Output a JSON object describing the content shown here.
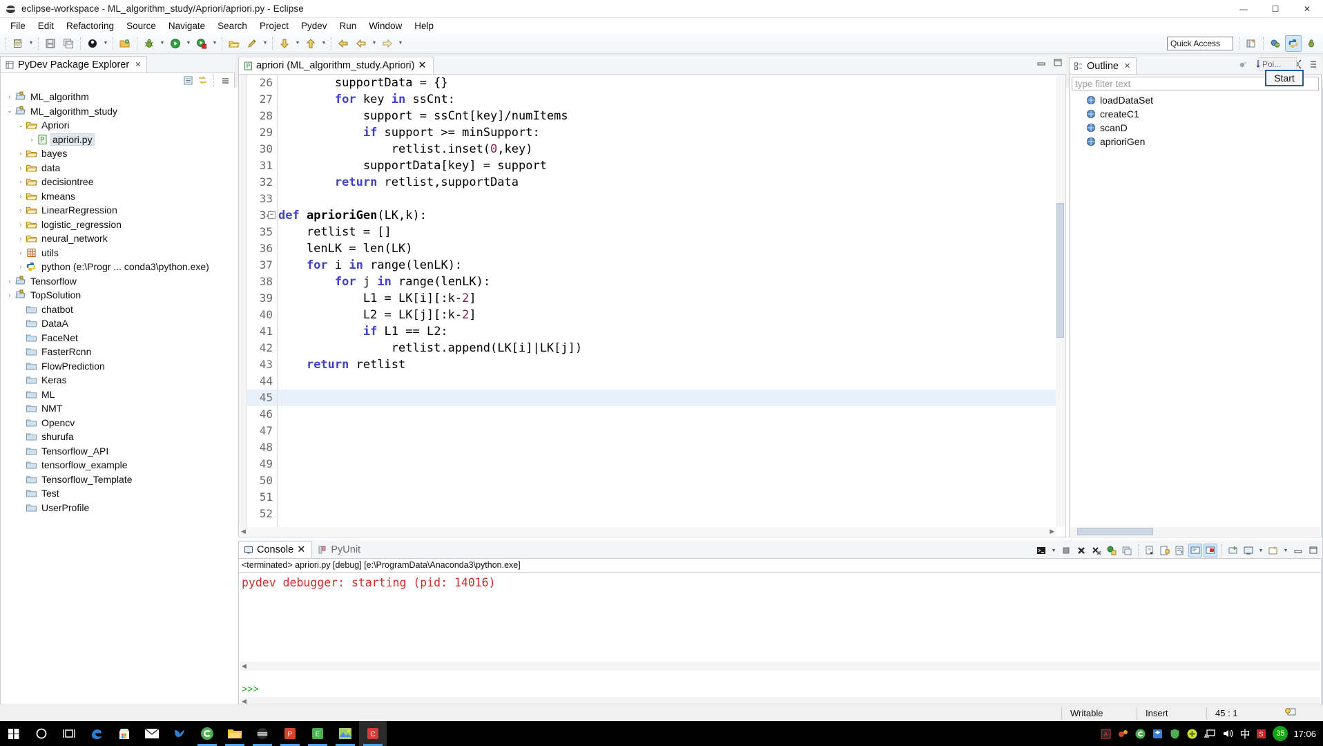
{
  "window": {
    "title": "eclipse-workspace - ML_algorithm_study/Apriori/apriori.py - Eclipse",
    "minimize": "—",
    "maximize": "☐",
    "close": "✕"
  },
  "menu": [
    "File",
    "Edit",
    "Refactoring",
    "Source",
    "Navigate",
    "Search",
    "Project",
    "Pydev",
    "Run",
    "Window",
    "Help"
  ],
  "toolbar": {
    "quick_access_placeholder": "Quick Access",
    "buttons": [
      {
        "name": "new-wizard",
        "icon": "new-file-icon"
      },
      {
        "name": "save",
        "icon": "save-icon"
      },
      {
        "name": "save-all",
        "icon": "save-all-icon"
      },
      {
        "name": "pydev-package",
        "icon": "black-circle-icon"
      },
      {
        "name": "open-folder",
        "icon": "open-folder-icon"
      },
      {
        "name": "debug",
        "icon": "bug-icon"
      },
      {
        "name": "run",
        "icon": "run-green-icon"
      },
      {
        "name": "coverage",
        "icon": "coverage-icon"
      },
      {
        "name": "external-tools",
        "icon": "toolbox-icon"
      },
      {
        "name": "pencil",
        "icon": "pencil-icon"
      },
      {
        "name": "next-annotation",
        "icon": "down-arrow-icon"
      },
      {
        "name": "previous-annotation",
        "icon": "up-arrow-icon"
      },
      {
        "name": "back",
        "icon": "back-arrow-icon"
      },
      {
        "name": "forward-left",
        "icon": "left-arrow-icon"
      },
      {
        "name": "forward",
        "icon": "right-arrow-icon"
      }
    ]
  },
  "package_explorer": {
    "tab_label": "PyDev Package Explorer",
    "tree": [
      {
        "label": "ML_algorithm",
        "indent": 0,
        "twist": "›",
        "icon": "project-icon",
        "selected": false
      },
      {
        "label": "ML_algorithm_study",
        "indent": 0,
        "twist": "⌄",
        "icon": "project-icon",
        "selected": false
      },
      {
        "label": "Apriori",
        "indent": 1,
        "twist": "⌄",
        "icon": "folder-icon",
        "selected": false
      },
      {
        "label": "apriori.py",
        "indent": 2,
        "twist": "›",
        "icon": "python-file-icon",
        "selected": true
      },
      {
        "label": "bayes",
        "indent": 1,
        "twist": "›",
        "icon": "folder-icon",
        "selected": false
      },
      {
        "label": "data",
        "indent": 1,
        "twist": "›",
        "icon": "folder-icon",
        "selected": false
      },
      {
        "label": "decisiontree",
        "indent": 1,
        "twist": "›",
        "icon": "folder-icon",
        "selected": false
      },
      {
        "label": "kmeans",
        "indent": 1,
        "twist": "›",
        "icon": "folder-icon",
        "selected": false
      },
      {
        "label": "LinearRegression",
        "indent": 1,
        "twist": "›",
        "icon": "folder-icon",
        "selected": false
      },
      {
        "label": "logistic_regression",
        "indent": 1,
        "twist": "›",
        "icon": "folder-icon",
        "selected": false
      },
      {
        "label": "neural_network",
        "indent": 1,
        "twist": "›",
        "icon": "folder-icon",
        "selected": false
      },
      {
        "label": "utils",
        "indent": 1,
        "twist": "›",
        "icon": "grid-icon",
        "selected": false
      },
      {
        "label": "python  (e:\\Progr ... conda3\\python.exe)",
        "indent": 1,
        "twist": "›",
        "icon": "python-interp-icon",
        "selected": false
      },
      {
        "label": "Tensorflow",
        "indent": 0,
        "twist": "›",
        "icon": "project-icon",
        "selected": false
      },
      {
        "label": "TopSolution",
        "indent": 0,
        "twist": "›",
        "icon": "project-icon",
        "selected": false
      },
      {
        "label": "chatbot",
        "indent": 1,
        "twist": "",
        "icon": "closed-folder-icon",
        "selected": false
      },
      {
        "label": "DataA",
        "indent": 1,
        "twist": "",
        "icon": "closed-folder-icon",
        "selected": false
      },
      {
        "label": "FaceNet",
        "indent": 1,
        "twist": "",
        "icon": "closed-folder-icon",
        "selected": false
      },
      {
        "label": "FasterRcnn",
        "indent": 1,
        "twist": "",
        "icon": "closed-folder-icon",
        "selected": false
      },
      {
        "label": "FlowPrediction",
        "indent": 1,
        "twist": "",
        "icon": "closed-folder-icon",
        "selected": false
      },
      {
        "label": "Keras",
        "indent": 1,
        "twist": "",
        "icon": "closed-folder-icon",
        "selected": false
      },
      {
        "label": "ML",
        "indent": 1,
        "twist": "",
        "icon": "closed-folder-icon",
        "selected": false
      },
      {
        "label": "NMT",
        "indent": 1,
        "twist": "",
        "icon": "closed-folder-icon",
        "selected": false
      },
      {
        "label": "Opencv",
        "indent": 1,
        "twist": "",
        "icon": "closed-folder-icon",
        "selected": false
      },
      {
        "label": "shurufa",
        "indent": 1,
        "twist": "",
        "icon": "closed-folder-icon",
        "selected": false
      },
      {
        "label": "Tensorflow_API",
        "indent": 1,
        "twist": "",
        "icon": "closed-folder-icon",
        "selected": false
      },
      {
        "label": "tensorflow_example",
        "indent": 1,
        "twist": "",
        "icon": "closed-folder-icon",
        "selected": false
      },
      {
        "label": "Tensorflow_Template",
        "indent": 1,
        "twist": "",
        "icon": "closed-folder-icon",
        "selected": false
      },
      {
        "label": "Test",
        "indent": 1,
        "twist": "",
        "icon": "closed-folder-icon",
        "selected": false
      },
      {
        "label": "UserProfile",
        "indent": 1,
        "twist": "",
        "icon": "closed-folder-icon",
        "selected": false
      }
    ]
  },
  "editor": {
    "tab_label": "apriori (ML_algorithm_study.Apriori)",
    "first_line_number": 26,
    "current_line": 45,
    "lines": [
      {
        "n": 26,
        "tokens": [
          {
            "t": "        supportData = {}",
            "c": ""
          }
        ]
      },
      {
        "n": 27,
        "tokens": [
          {
            "t": "        ",
            "c": ""
          },
          {
            "t": "for",
            "c": "kw"
          },
          {
            "t": " key ",
            "c": ""
          },
          {
            "t": "in",
            "c": "kw"
          },
          {
            "t": " ssCnt:",
            "c": ""
          }
        ]
      },
      {
        "n": 28,
        "tokens": [
          {
            "t": "            support = ssCnt[key]/numItems",
            "c": ""
          }
        ]
      },
      {
        "n": 29,
        "tokens": [
          {
            "t": "            ",
            "c": ""
          },
          {
            "t": "if",
            "c": "kw"
          },
          {
            "t": " support >= minSupport:",
            "c": ""
          }
        ]
      },
      {
        "n": 30,
        "tokens": [
          {
            "t": "                retlist.inset(",
            "c": ""
          },
          {
            "t": "0",
            "c": "num"
          },
          {
            "t": ",key)",
            "c": ""
          }
        ]
      },
      {
        "n": 31,
        "tokens": [
          {
            "t": "            supportData[key] = support",
            "c": ""
          }
        ]
      },
      {
        "n": 32,
        "tokens": [
          {
            "t": "        ",
            "c": ""
          },
          {
            "t": "return",
            "c": "kw"
          },
          {
            "t": " retlist,supportData",
            "c": ""
          }
        ]
      },
      {
        "n": 33,
        "tokens": [
          {
            "t": "",
            "c": ""
          }
        ]
      },
      {
        "n": 34,
        "fold": true,
        "tokens": [
          {
            "t": "def",
            "c": "kw"
          },
          {
            "t": " ",
            "c": ""
          },
          {
            "t": "aprioriGen",
            "c": "fname"
          },
          {
            "t": "(LK,k):",
            "c": ""
          }
        ]
      },
      {
        "n": 35,
        "tokens": [
          {
            "t": "    retlist = []",
            "c": ""
          }
        ]
      },
      {
        "n": 36,
        "tokens": [
          {
            "t": "    lenLK = len(LK)",
            "c": ""
          }
        ]
      },
      {
        "n": 37,
        "tokens": [
          {
            "t": "    ",
            "c": ""
          },
          {
            "t": "for",
            "c": "kw"
          },
          {
            "t": " i ",
            "c": ""
          },
          {
            "t": "in",
            "c": "kw"
          },
          {
            "t": " range(lenLK):",
            "c": ""
          }
        ]
      },
      {
        "n": 38,
        "tokens": [
          {
            "t": "        ",
            "c": ""
          },
          {
            "t": "for",
            "c": "kw"
          },
          {
            "t": " j ",
            "c": ""
          },
          {
            "t": "in",
            "c": "kw"
          },
          {
            "t": " range(lenLK):",
            "c": ""
          }
        ]
      },
      {
        "n": 39,
        "tokens": [
          {
            "t": "            L1 = LK[i][:k-",
            "c": ""
          },
          {
            "t": "2",
            "c": "num"
          },
          {
            "t": "]",
            "c": ""
          }
        ]
      },
      {
        "n": 40,
        "tokens": [
          {
            "t": "            L2 = LK[j][:k-",
            "c": ""
          },
          {
            "t": "2",
            "c": "num"
          },
          {
            "t": "]",
            "c": ""
          }
        ]
      },
      {
        "n": 41,
        "tokens": [
          {
            "t": "            ",
            "c": ""
          },
          {
            "t": "if",
            "c": "kw"
          },
          {
            "t": " L1 == L2:",
            "c": ""
          }
        ]
      },
      {
        "n": 42,
        "tokens": [
          {
            "t": "                retlist.append(LK[i]|LK[j])",
            "c": ""
          }
        ]
      },
      {
        "n": 43,
        "tokens": [
          {
            "t": "    ",
            "c": ""
          },
          {
            "t": "return",
            "c": "kw"
          },
          {
            "t": " retlist",
            "c": ""
          }
        ]
      },
      {
        "n": 44,
        "tokens": [
          {
            "t": "",
            "c": ""
          }
        ]
      },
      {
        "n": 45,
        "tokens": [
          {
            "t": "",
            "c": ""
          }
        ]
      },
      {
        "n": 46,
        "tokens": [
          {
            "t": "",
            "c": ""
          }
        ]
      },
      {
        "n": 47,
        "tokens": [
          {
            "t": "",
            "c": ""
          }
        ]
      },
      {
        "n": 48,
        "tokens": [
          {
            "t": "",
            "c": ""
          }
        ]
      },
      {
        "n": 49,
        "tokens": [
          {
            "t": "",
            "c": ""
          }
        ]
      },
      {
        "n": 50,
        "tokens": [
          {
            "t": "",
            "c": ""
          }
        ]
      },
      {
        "n": 51,
        "tokens": [
          {
            "t": "",
            "c": ""
          }
        ]
      },
      {
        "n": 52,
        "tokens": [
          {
            "t": "",
            "c": ""
          }
        ]
      }
    ]
  },
  "outline": {
    "tab_label": "Outline",
    "filter_placeholder": "type filter text",
    "tooltip_text": "Poi...",
    "start_button": "Start",
    "items": [
      "loadDataSet",
      "createC1",
      "scanD",
      "aprioriGen"
    ]
  },
  "console": {
    "tabs": [
      {
        "label": "Console",
        "active": true,
        "icon": "console-icon"
      },
      {
        "label": "PyUnit",
        "active": false,
        "icon": "pyunit-icon"
      }
    ],
    "process_line": "<terminated> apriori.py [debug] [e:\\ProgramData\\Anaconda3\\python.exe]",
    "output_line": "pydev debugger: starting (pid: 14016)",
    "prompt": ">>>"
  },
  "status_bar": {
    "writable": "Writable",
    "insert": "Insert",
    "position": "45 : 1"
  },
  "taskbar": {
    "clock": "17:06",
    "ime": "中",
    "badge": "35"
  },
  "colors": {
    "keyword": "#4040c8",
    "number": "#8b1a4a",
    "console_error": "#d22b2b",
    "console_prompt": "#17a317",
    "selection": "#dfe7ee",
    "current_line": "#e8f0fa",
    "accent_border": "#1a5c9e"
  }
}
